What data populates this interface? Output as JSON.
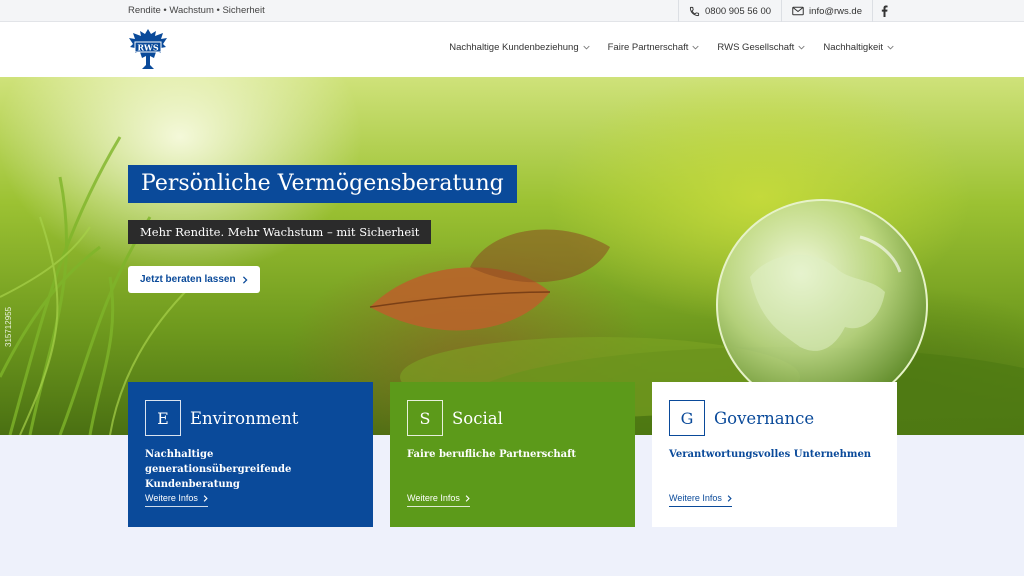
{
  "topbar": {
    "tagline": "Rendite • Wachstum • Sicherheit",
    "phone": "0800 905 56 00",
    "email": "info@rws.de"
  },
  "logo_text": "RWS",
  "nav": [
    {
      "label": "Nachhaltige Kundenbeziehung"
    },
    {
      "label": "Faire Partnerschaft"
    },
    {
      "label": "RWS Gesellschaft"
    },
    {
      "label": "Nachhaltigkeit"
    }
  ],
  "hero": {
    "title": "Persönliche Vermögensberatung",
    "subtitle": "Mehr Rendite. Mehr Wachstum – mit Sicherheit",
    "cta": "Jetzt beraten lassen",
    "watermark": "315712955"
  },
  "cards": [
    {
      "letter": "E",
      "title": "Environment",
      "desc": "Nachhaltige generationsübergreifende Kundenberatung",
      "more": "Weitere Infos"
    },
    {
      "letter": "S",
      "title": "Social",
      "desc": "Faire berufliche Partnerschaft",
      "more": "Weitere Infos"
    },
    {
      "letter": "G",
      "title": "Governance",
      "desc": "Verantwortungsvolles Unternehmen",
      "more": "Weitere Infos"
    }
  ],
  "colors": {
    "brand_blue": "#0a4a9a",
    "green": "#5c9a1a",
    "dark": "#2b2b2b"
  },
  "icons": [
    "phone-icon",
    "mail-icon",
    "facebook-icon",
    "chevron-down-icon",
    "chevron-right-icon",
    "eagle-logo"
  ]
}
